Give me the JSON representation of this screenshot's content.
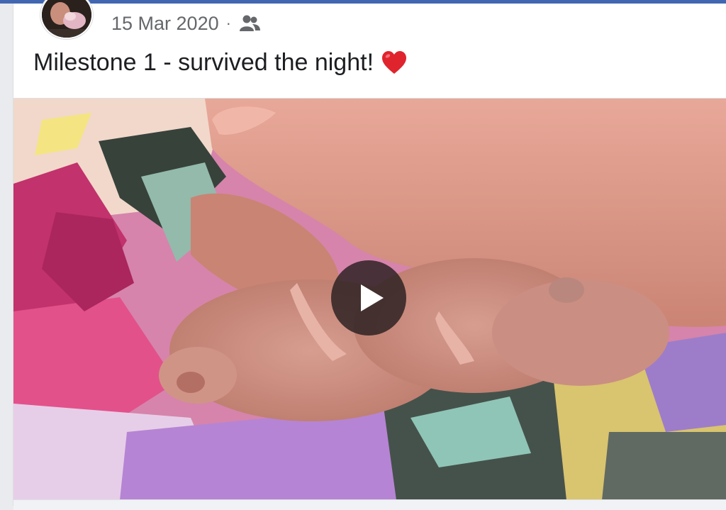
{
  "post": {
    "date": "15 Mar 2020",
    "separator": "·",
    "audience_icon": "friends-icon",
    "text": "Milestone 1 - survived the night!",
    "emoji": "red-heart"
  },
  "media": {
    "type": "video",
    "play_icon": "play-icon"
  },
  "colors": {
    "brand_bar": "#4267b2",
    "meta_text": "#65676b",
    "body_text": "#1c1e21",
    "heart": "#e0242e"
  }
}
